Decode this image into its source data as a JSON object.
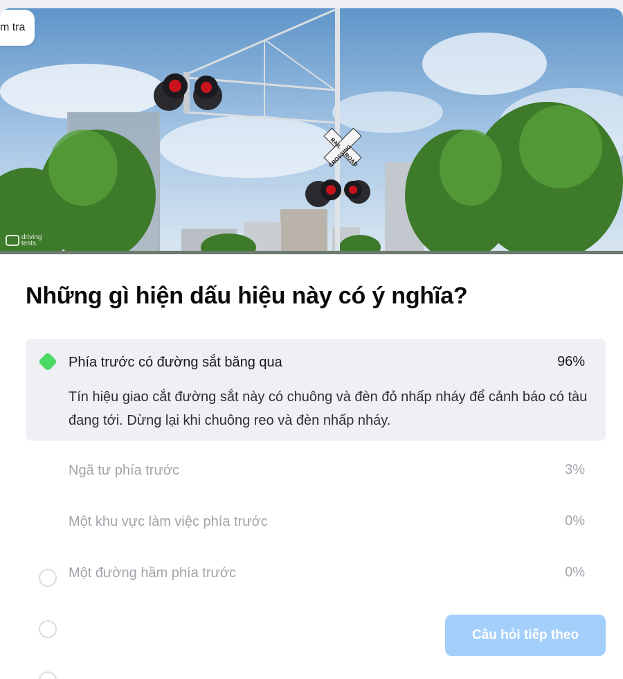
{
  "quiz_tag": "m tra",
  "watermark": {
    "line1": "driving",
    "line2": "tests"
  },
  "sign_text": {
    "top": "RAIL",
    "right": "ROAD",
    "cross": "CROSSING"
  },
  "question": "Những gì hiện dấu hiệu này có ý nghĩa?",
  "options": [
    {
      "label": "Phía trước có đường sắt băng qua",
      "percent": "96%",
      "selected": true,
      "explanation": "Tín hiệu giao cắt đường sắt này có chuông và đèn đỏ nhấp nháy để cảnh báo có tàu đang tới. Dừng lại khi chuông reo và đèn nhấp nháy."
    },
    {
      "label": "Ngã tư phía trước",
      "percent": "3%",
      "selected": false
    },
    {
      "label": "Một khu vực làm việc phía trước",
      "percent": "0%",
      "selected": false
    },
    {
      "label": "Một đường hầm phía trước",
      "percent": "0%",
      "selected": false
    }
  ],
  "next_button": "Câu hỏi tiếp theo",
  "colors": {
    "correct": "#4cd964",
    "button": "#a5cffb",
    "selected_bg": "#f0f0f4"
  }
}
